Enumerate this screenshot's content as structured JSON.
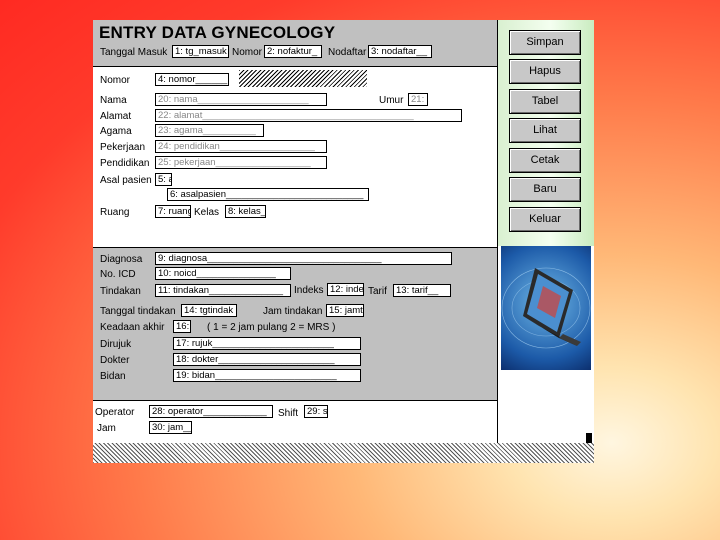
{
  "title": "ENTRY DATA GYNECOLOGY",
  "header": {
    "tanggal_masuk_label": "Tanggal Masuk",
    "tanggal_masuk_value": "1: tg_masuk",
    "nomor_label": "Nomor",
    "nomor_value": "2: nofaktur_",
    "nodaftar_label": "Nodaftar",
    "nodaftar_value": "3: nodaftar__"
  },
  "patient": {
    "nomor_label": "Nomor",
    "nomor_value": "4: nomor______",
    "nama_label": "Nama",
    "nama_value": "20: nama_____________________",
    "umur_label": "Umur",
    "umur_value": "21:",
    "alamat_label": "Alamat",
    "alamat_value": "22: alamat________________________________________",
    "agama_label": "Agama",
    "agama_value": "23: agama__________",
    "pekerjaan_label": "Pekerjaan",
    "pekerjaan_value": "24: pendidikan__________________",
    "pendidikan_label": "Pendidikan",
    "pendidikan_value": "25: pekerjaan__________________",
    "asal_label": "Asal pasien",
    "asal_code": "5: a",
    "asalpasien_value": "6: asalpasien__________________________",
    "ruang_label": "Ruang",
    "ruang_value": "7: ruang",
    "kelas_label": "Kelas",
    "kelas_value": "8: kelas_"
  },
  "diagnosis": {
    "diagnosa_label": "Diagnosa",
    "diagnosa_value": "9: diagnosa_________________________________",
    "icd_label": "No. ICD",
    "icd_value": "10: noicd_______________",
    "tindakan_label": "Tindakan",
    "tindakan_value": "11: tindakan______________",
    "indeks_label": "Indeks",
    "indeks_value": "12: inde",
    "tarif_label": "Tarif",
    "tarif_value": "13: tarif__",
    "tgl_tindakan_label": "Tanggal tindakan",
    "tgl_tindakan_value": "14: tgtindak",
    "jam_tindakan_label": "Jam tindakan",
    "jam_tindakan_value": "15: jamt",
    "keadaan_label": "Keadaan akhir",
    "keadaan_value": "16:",
    "keadaan_hint": "( 1 = 2 jam pulang    2 = MRS )",
    "dirujuk_label": "Dirujuk",
    "dirujuk_value": "17: rujuk_______________________",
    "dokter_label": "Dokter",
    "dokter_value": "18: dokter______________________",
    "bidan_label": "Bidan",
    "bidan_value": "19: bidan_______________________"
  },
  "footer": {
    "operator_label": "Operator",
    "operator_value": "28: operator____________",
    "shift_label": "Shift",
    "shift_value": "29: s",
    "jam_label": "Jam",
    "jam_value": "30: jam__"
  },
  "buttons": {
    "simpan": "Simpan",
    "hapus": "Hapus",
    "tabel": "Tabel",
    "lihat": "Lihat",
    "cetak": "Cetak",
    "baru": "Baru",
    "keluar": "Keluar"
  }
}
